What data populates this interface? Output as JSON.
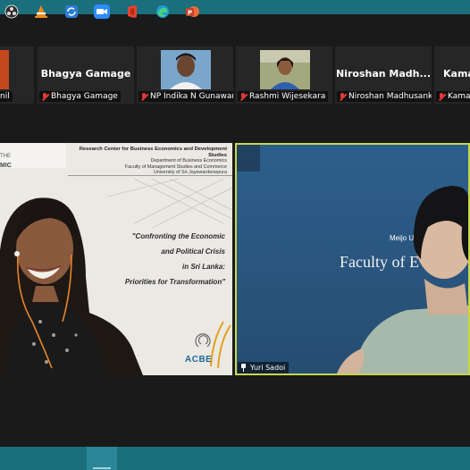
{
  "participants": [
    {
      "display": "",
      "caption": "nil",
      "muted": false
    },
    {
      "display": "Bhagya Gamage",
      "caption": "Bhagya Gamage",
      "muted": true
    },
    {
      "display": "",
      "caption": "NP Indika N Gunawar...",
      "muted": true
    },
    {
      "display": "",
      "caption": "Rashmi Wijesekara",
      "muted": true
    },
    {
      "display": "Niroshan  Madh...",
      "caption": "Niroshan Madhusank...",
      "muted": true
    },
    {
      "display": "Kamal",
      "caption": "Kamal",
      "muted": true
    }
  ],
  "slide": {
    "org": "Research Center for Business Economics and Development Studies",
    "dept": "Department of Business Economics",
    "faculty": "Faculty of Management Studies and Commerce",
    "university": "University of Sri Jayewardenepura",
    "left_the": "THE",
    "left_mic": "MIC",
    "title_lines": [
      "\"Confronting the Economic",
      "and Political Crisis",
      "in Sri Lanka:",
      "Priorities for Transformation\""
    ],
    "logo_text": "ACBE"
  },
  "speaker": {
    "name": "Yuri Sadoi",
    "sign_line1": "Meijo U",
    "sign_line2": "Faculty of E"
  },
  "taskbar": {
    "icons": [
      "obs-icon",
      "vlc-icon",
      "sync-icon",
      "zoom-icon",
      "office-icon",
      "edge-icon",
      "powerpoint-icon"
    ]
  },
  "colors": {
    "teal_bar": "#1b6f7c",
    "active_speaker_border": "#c6d74a",
    "mic_muted": "#e53935"
  }
}
